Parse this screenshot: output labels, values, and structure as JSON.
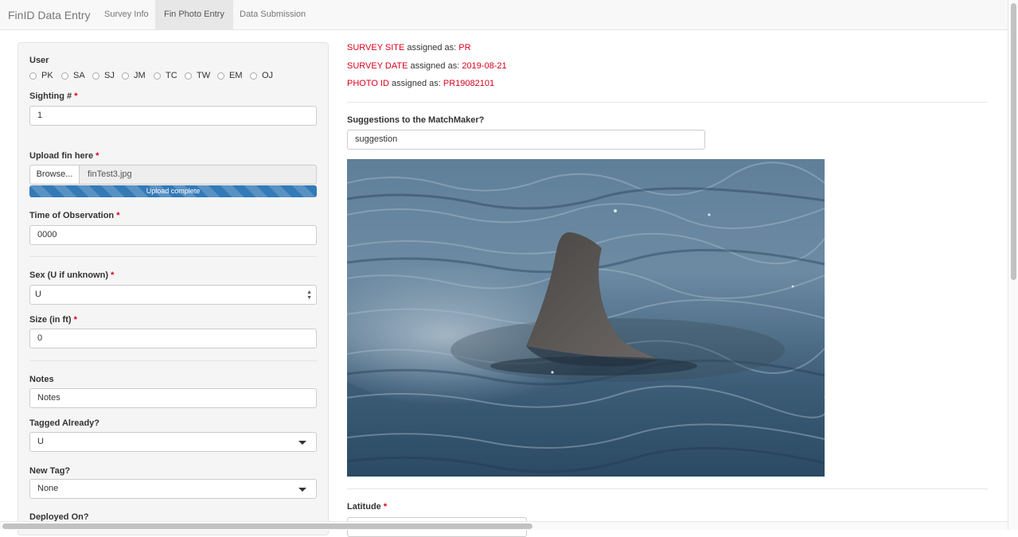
{
  "navbar": {
    "brand": "FinID Data Entry",
    "tabs": [
      {
        "label": "Survey Info",
        "active": false
      },
      {
        "label": "Fin Photo Entry",
        "active": true
      },
      {
        "label": "Data Submission",
        "active": false
      }
    ]
  },
  "form": {
    "user": {
      "label": "User",
      "options": [
        "PK",
        "SA",
        "SJ",
        "JM",
        "TC",
        "TW",
        "EM",
        "OJ"
      ]
    },
    "required_mark": "*",
    "sighting": {
      "label": "Sighting #",
      "value": "1"
    },
    "upload": {
      "label": "Upload fin here",
      "browse_label": "Browse...",
      "file_name": "finTest3.jpg",
      "progress_text": "Upload complete",
      "progress_fraction": 1.0
    },
    "time_of_observation": {
      "label": "Time of Observation",
      "value": "0000"
    },
    "sex": {
      "label": "Sex (U if unknown)",
      "value": "U"
    },
    "size": {
      "label": "Size (in ft)",
      "value": "0"
    },
    "notes": {
      "label": "Notes",
      "value": "Notes"
    },
    "tagged_already": {
      "label": "Tagged Already?",
      "value": "U"
    },
    "new_tag": {
      "label": "New Tag?",
      "value": "None"
    },
    "deployed_on": {
      "label": "Deployed On?"
    }
  },
  "assignments": [
    {
      "key": "SURVEY SITE",
      "middle": "assigned as:",
      "value": "PR"
    },
    {
      "key": "SURVEY DATE",
      "middle": "assigned as:",
      "value": "2019-08-21"
    },
    {
      "key": "PHOTO ID",
      "middle": "assigned as:",
      "value": "PR19082101"
    }
  ],
  "suggestions": {
    "label": "Suggestions to the MatchMaker?",
    "value": "suggestion"
  },
  "latitude": {
    "label": "Latitude"
  },
  "colors": {
    "accent_red": "#d9001b",
    "progress_blue": "#337ab7",
    "ocean": "#4a6c8a",
    "fin": "#5a5654"
  }
}
